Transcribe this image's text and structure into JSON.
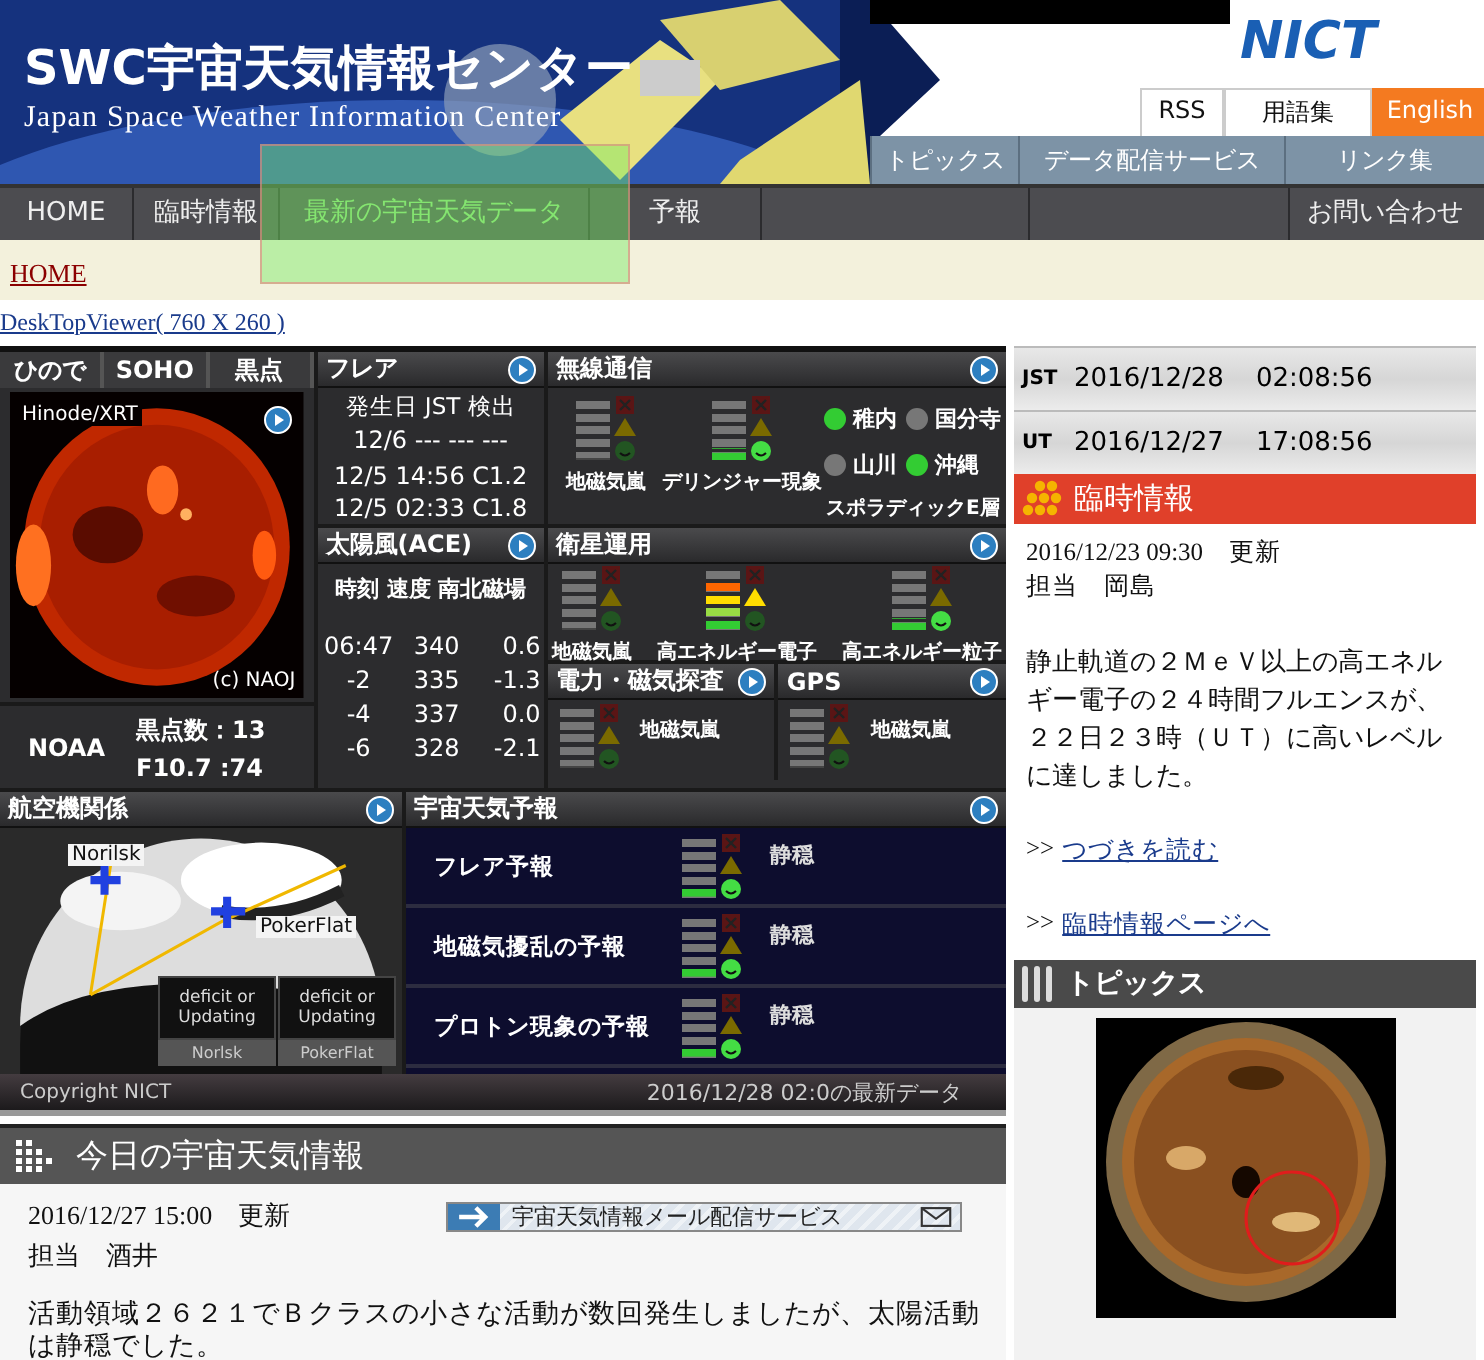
{
  "header": {
    "logo_title": "SWC宇宙天気情報センター",
    "logo_subtitle": "Japan Space Weather Information Center",
    "org_logo": "NICT",
    "util_links": [
      {
        "label": "RSS",
        "kind": "plain"
      },
      {
        "label": "用語集",
        "kind": "plain"
      },
      {
        "label": "English",
        "kind": "accent"
      }
    ],
    "sub_nav": [
      "トピックス",
      "データ配信サービス",
      "リンク集"
    ]
  },
  "nav": [
    {
      "label": "HOME",
      "selected": false
    },
    {
      "label": "臨時情報",
      "selected": false
    },
    {
      "label": "最新の宇宙天気データ",
      "selected": true
    },
    {
      "label": "予報",
      "selected": false
    },
    {
      "label": "お問い合わせ",
      "selected": false
    }
  ],
  "breadcrumb": "HOME",
  "desktop_link": "DeskTopViewer( 760 X 260 )",
  "solar": {
    "tabs": [
      "ひので",
      "SOHO",
      "黒点"
    ],
    "image_label": "Hinode/XRT",
    "credit": "(c) NAOJ",
    "noaa": "NOAA",
    "sunspots": "黒点数：13",
    "f107": "F10.7  :74"
  },
  "flare": {
    "title": "フレア",
    "header": "発生日 JST 検出",
    "rows": [
      "12/6 --- --- ---",
      "12/5 14:56 C1.2",
      "12/5 02:33 C1.8"
    ]
  },
  "solar_wind": {
    "title": "太陽風(ACE)",
    "header": "時刻 速度 南北磁場",
    "rows": [
      [
        "06:47",
        "340",
        "0.6"
      ],
      [
        "-2",
        "335",
        "-1.3"
      ],
      [
        "-4",
        "337",
        "0.0"
      ],
      [
        "-6",
        "328",
        "-2.1"
      ]
    ]
  },
  "radio": {
    "title": "無線通信",
    "meters": [
      {
        "label": "地磁気嵐",
        "level": 0
      },
      {
        "label": "デリンジャー現象",
        "level": 0.2
      }
    ],
    "stations": [
      {
        "name": "稚内",
        "on": true
      },
      {
        "name": "国分寺",
        "on": false
      },
      {
        "name": "山川",
        "on": false
      },
      {
        "name": "沖縄",
        "on": true
      }
    ],
    "stations_label": "スポラディックE層"
  },
  "satellite": {
    "title": "衛星運用",
    "meters": [
      {
        "label": "地磁気嵐",
        "level": 0
      },
      {
        "label": "高エネルギー電子",
        "level": 0.8
      },
      {
        "label": "高エネルギー粒子",
        "level": 0.2
      }
    ]
  },
  "power": {
    "title": "電力・磁気探査",
    "meter": {
      "label": "地磁気嵐",
      "level": 0
    }
  },
  "gps": {
    "title": "GPS",
    "meter": {
      "label": "地磁気嵐",
      "level": 0
    }
  },
  "aviation": {
    "title": "航空機関係",
    "places": [
      "Norilsk",
      "PokerFlat"
    ],
    "status": [
      {
        "text": "deficit or Updating",
        "place": "Norlsk"
      },
      {
        "text": "deficit or Updating",
        "place": "PokerFlat"
      }
    ]
  },
  "forecast": {
    "title": "宇宙天気予報",
    "rows": [
      {
        "label": "フレア予報",
        "level": 0.2,
        "status": "静穏"
      },
      {
        "label": "地磁気擾乱の予報",
        "level": 0.2,
        "status": "静穏"
      },
      {
        "label": "プロトン現象の予報",
        "level": 0.2,
        "status": "静穏"
      }
    ]
  },
  "dashboard_footer": {
    "copyright": "Copyright NICT",
    "updated": "2016/12/28 02:0の最新データ"
  },
  "clock": [
    {
      "zone": "JST",
      "date": "2016/12/28",
      "time": "02:08:56"
    },
    {
      "zone": "UT",
      "date": "2016/12/27",
      "time": "17:08:56"
    }
  ],
  "alert": {
    "title": "臨時情報",
    "updated": "2016/12/23 09:30　更新",
    "author": "担当　岡島",
    "body": "静止軌道の２ＭｅＶ以上の高エネルギー電子の２４時間フルエンスが、２２日２３時（ＵＴ）に高いレベルに達しました。",
    "links": [
      {
        "prefix": ">>",
        "label": "つづきを読む"
      },
      {
        "prefix": ">>",
        "label": "臨時情報ページへ"
      }
    ]
  },
  "topics": {
    "title": "トピックス"
  },
  "today": {
    "title": "今日の宇宙天気情報",
    "updated": "2016/12/27 15:00　更新",
    "author": "担当　酒井",
    "mail_button": "宇宙天気情報メール配信サービス",
    "body": "活動領域２６２１でＢクラスの小さな活動が数回発生しましたが、太陽活動は静穏でした。"
  }
}
